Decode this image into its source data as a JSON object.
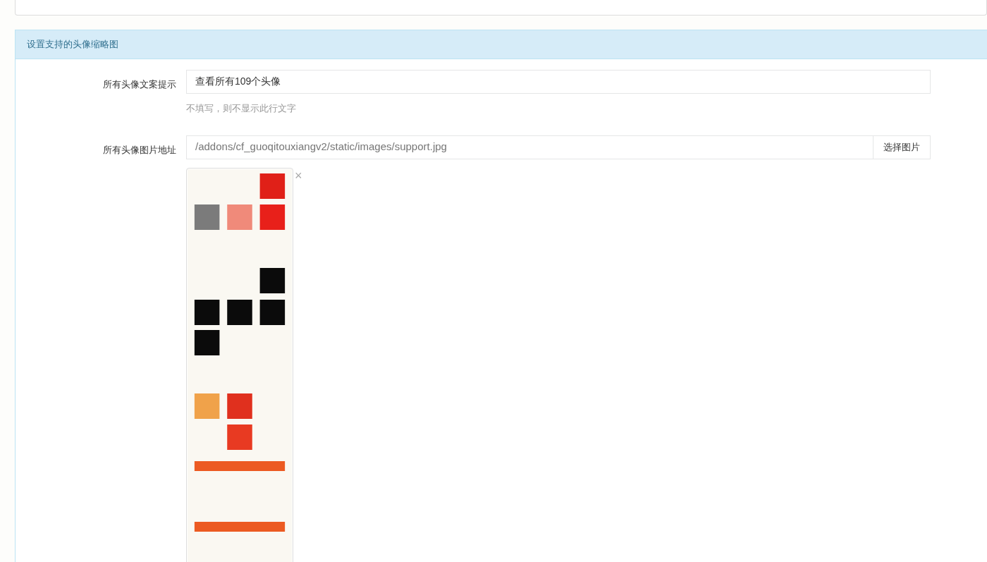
{
  "panel": {
    "title": "设置支持的头像缩略图"
  },
  "fields": [
    {
      "kind": "text",
      "label": "所有头像文案提示",
      "value": "查看所有109个头像",
      "help": "不填写，则不显示此行文字"
    },
    {
      "label": "所有头像图片地址",
      "value": "/addons/cf_guoqitouxiangv2/static/images/support.jpg",
      "button": "选择图片",
      "remove": "×"
    }
  ]
}
